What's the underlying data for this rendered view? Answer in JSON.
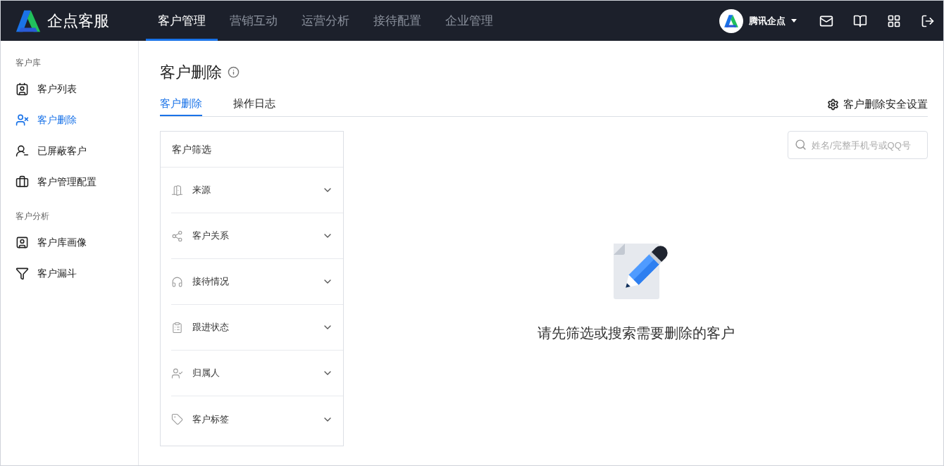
{
  "brand": {
    "name": "企点客服"
  },
  "top_nav": [
    {
      "label": "客户管理",
      "selected": true
    },
    {
      "label": "营销互动",
      "selected": false
    },
    {
      "label": "运营分析",
      "selected": false
    },
    {
      "label": "接待配置",
      "selected": false
    },
    {
      "label": "企业管理",
      "selected": false
    }
  ],
  "account": {
    "name": "腾讯企点"
  },
  "sidebar": [
    {
      "heading": "客户库",
      "items": [
        {
          "label": "客户列表",
          "selected": false
        },
        {
          "label": "客户删除",
          "selected": true
        },
        {
          "label": "已屏蔽客户",
          "selected": false
        },
        {
          "label": "客户管理配置",
          "selected": false
        }
      ]
    },
    {
      "heading": "客户分析",
      "items": [
        {
          "label": "客户库画像",
          "selected": false
        },
        {
          "label": "客户漏斗",
          "selected": false
        }
      ]
    }
  ],
  "page": {
    "title": "客户删除"
  },
  "tabs": [
    {
      "label": "客户删除",
      "selected": true
    },
    {
      "label": "操作日志",
      "selected": false
    }
  ],
  "settings_link": "客户删除安全设置",
  "filter": {
    "title": "客户筛选",
    "items": [
      {
        "label": "来源",
        "expanded": false
      },
      {
        "label": "客户关系",
        "expanded": false
      },
      {
        "label": "接待情况",
        "expanded": false
      },
      {
        "label": "跟进状态",
        "expanded": false
      },
      {
        "label": "归属人",
        "expanded": false
      },
      {
        "label": "客户标签",
        "expanded": false
      }
    ]
  },
  "search": {
    "placeholder": "姓名/完整手机号或QQ号"
  },
  "empty_state": {
    "message": "请先筛选或搜索需要删除的客户"
  }
}
